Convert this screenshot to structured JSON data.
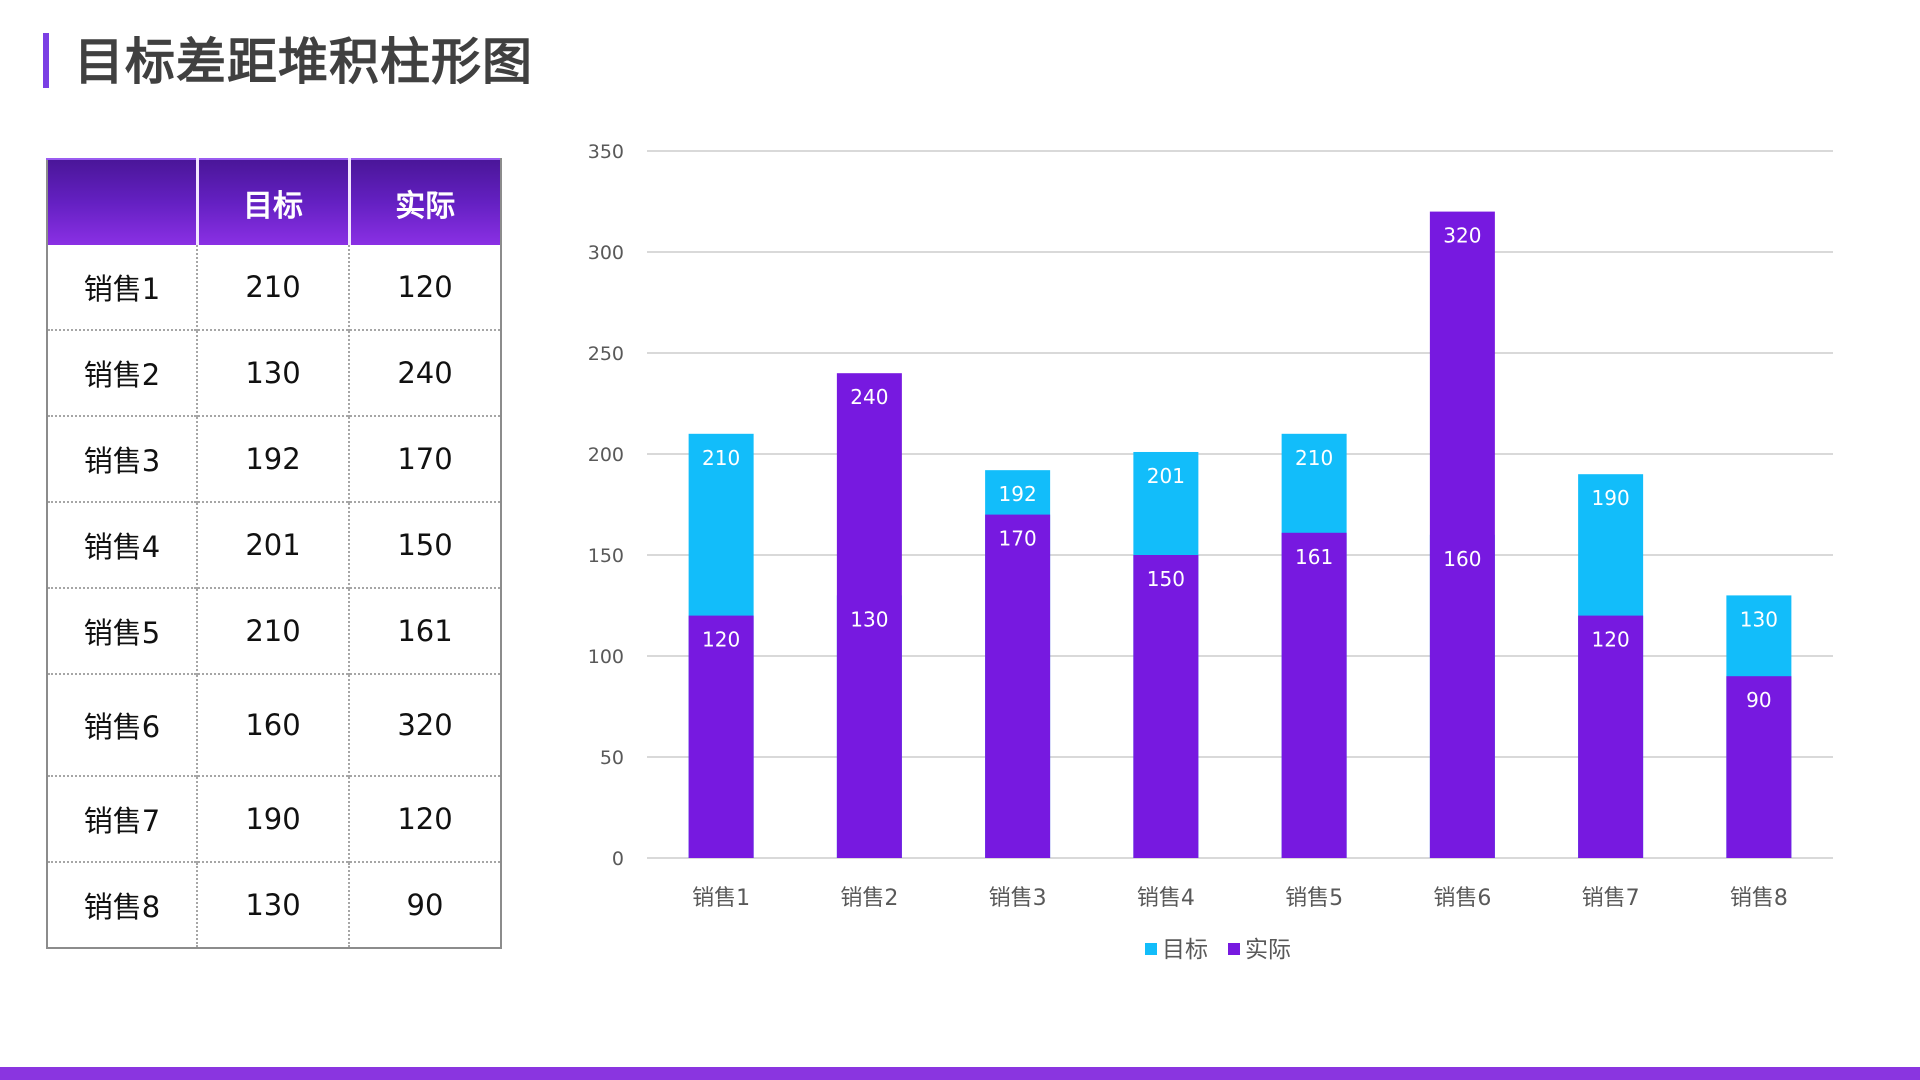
{
  "header": {
    "title": "目标差距堆积柱形图",
    "accent_color": "#7b3fe4"
  },
  "table": {
    "columns": [
      "",
      "目标",
      "实际"
    ],
    "rows": [
      {
        "name": "销售1",
        "target": "210",
        "actual": "120"
      },
      {
        "name": "销售2",
        "target": "130",
        "actual": "240"
      },
      {
        "name": "销售3",
        "target": "192",
        "actual": "170"
      },
      {
        "name": "销售4",
        "target": "201",
        "actual": "150"
      },
      {
        "name": "销售5",
        "target": "210",
        "actual": "161"
      },
      {
        "name": "销售6",
        "target": "160",
        "actual": "320"
      },
      {
        "name": "销售7",
        "target": "190",
        "actual": "120"
      },
      {
        "name": "销售8",
        "target": "130",
        "actual": "90"
      }
    ]
  },
  "chart_data": {
    "type": "bar",
    "title": "",
    "xlabel": "",
    "ylabel": "",
    "categories": [
      "销售1",
      "销售2",
      "销售3",
      "销售4",
      "销售5",
      "销售6",
      "销售7",
      "销售8"
    ],
    "series": [
      {
        "name": "目标",
        "color": "#12bdfa",
        "values": [
          210,
          130,
          192,
          201,
          210,
          160,
          190,
          130
        ]
      },
      {
        "name": "实际",
        "color": "#7719e0",
        "values": [
          120,
          240,
          170,
          150,
          161,
          320,
          120,
          90
        ]
      }
    ],
    "overlap": "full (实际 drawn in front of 目标)",
    "ylim": [
      0,
      350
    ],
    "yticks": [
      0,
      50,
      100,
      150,
      200,
      250,
      300,
      350
    ],
    "grid": true,
    "data_labels": true,
    "legend": "bottom"
  },
  "footer_band_color": "#8a35e0"
}
